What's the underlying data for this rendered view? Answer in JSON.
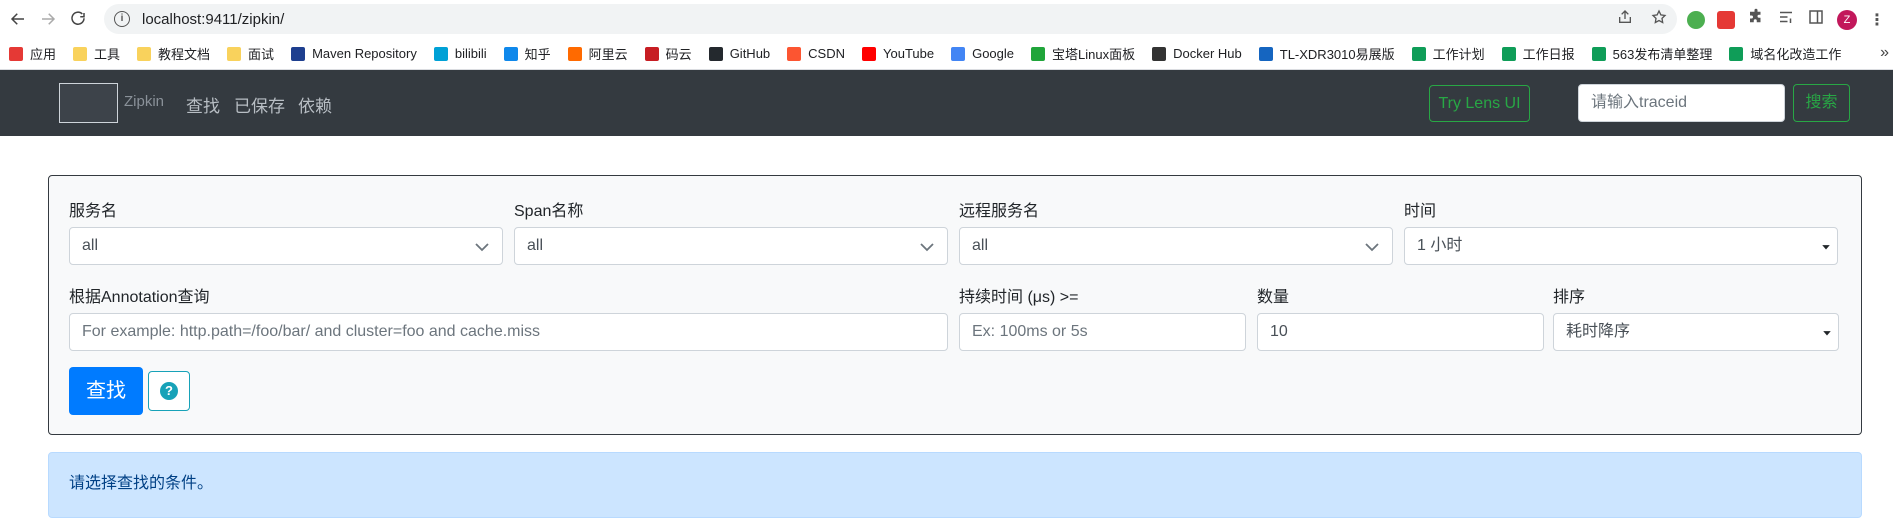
{
  "browser": {
    "url": "localhost:9411/zipkin/",
    "profile_initial": "Z",
    "bookmarks": [
      {
        "label": "应用",
        "color": "#e53935"
      },
      {
        "label": "工具",
        "color": "#f9d25c"
      },
      {
        "label": "教程文档",
        "color": "#f9d25c"
      },
      {
        "label": "面试",
        "color": "#f9d25c"
      },
      {
        "label": "Maven Repository",
        "color": "#1e3f8f"
      },
      {
        "label": "bilibili",
        "color": "#00a1d6"
      },
      {
        "label": "知乎",
        "color": "#0f88eb"
      },
      {
        "label": "阿里云",
        "color": "#ff6a00"
      },
      {
        "label": "码云",
        "color": "#c71d23"
      },
      {
        "label": "GitHub",
        "color": "#24292e"
      },
      {
        "label": "CSDN",
        "color": "#fc5531"
      },
      {
        "label": "YouTube",
        "color": "#ff0000"
      },
      {
        "label": "Google",
        "color": "#4285f4"
      },
      {
        "label": "宝塔Linux面板",
        "color": "#20a53a"
      },
      {
        "label": "Docker Hub",
        "color": "#333333"
      },
      {
        "label": "TL-XDR3010易展版",
        "color": "#1565c0"
      },
      {
        "label": "工作计划",
        "color": "#0f9d58"
      },
      {
        "label": "工作日报",
        "color": "#0f9d58"
      },
      {
        "label": "563发布清单整理",
        "color": "#0f9d58"
      },
      {
        "label": "域名化改造工作",
        "color": "#0f9d58"
      }
    ]
  },
  "navbar": {
    "brand": "Zipkin",
    "links": [
      "查找",
      "已保存",
      "依赖"
    ],
    "lens_button": "Try Lens UI",
    "traceid_placeholder": "请输入traceid",
    "search_button": "搜索"
  },
  "form": {
    "service_label": "服务名",
    "service_value": "all",
    "span_label": "Span名称",
    "span_value": "all",
    "remote_label": "远程服务名",
    "remote_value": "all",
    "time_label": "时间",
    "time_value": "1 小时",
    "annotation_label": "根据Annotation查询",
    "annotation_placeholder": "For example: http.path=/foo/bar/ and cluster=foo and cache.miss",
    "duration_label": "持续时间 (μs) >=",
    "duration_placeholder": "Ex: 100ms or 5s",
    "limit_label": "数量",
    "limit_value": "10",
    "sort_label": "排序",
    "sort_value": "耗时降序",
    "find_button": "查找",
    "help_symbol": "?"
  },
  "alert": {
    "message": "请选择查找的条件。"
  },
  "colors": {
    "navbar_bg": "#343a40",
    "success": "#28a745",
    "primary": "#007bff",
    "info": "#17a2b8",
    "alert_bg": "#cce5ff"
  }
}
